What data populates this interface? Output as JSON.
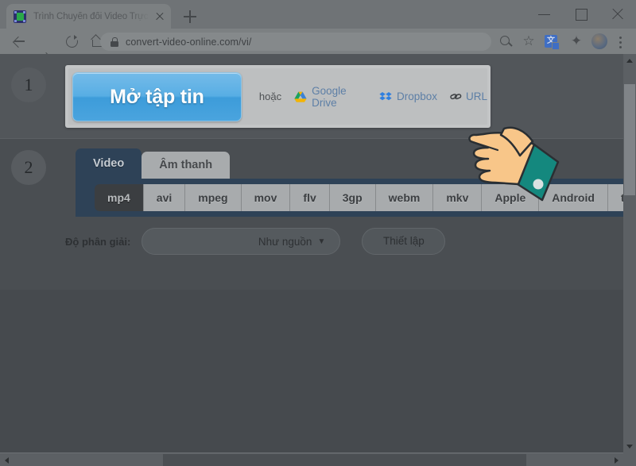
{
  "browser": {
    "tab": {
      "title": "Trình Chuyển đổi Video Trực tuyến",
      "favicon": "video-converter-favicon",
      "close_icon": "close-icon"
    },
    "new_tab_label": "+",
    "window_controls": {
      "minimize": "minimize-icon",
      "maximize": "maximize-icon",
      "close": "close-icon"
    },
    "nav": {
      "back": "back-arrow-icon",
      "forward": "forward-arrow-icon",
      "reload": "reload-icon",
      "home": "home-icon"
    },
    "omnibox": {
      "lock": "lock-icon",
      "url": "convert-video-online.com/vi/"
    },
    "toolbar_icons": {
      "zoom": "search-zoom-icon",
      "bookmark": "star-icon",
      "translate": "translate-icon",
      "translate_glyph": "文",
      "extensions": "puzzle-piece-icon",
      "avatar": "profile-avatar",
      "menu": "three-dot-menu-icon"
    }
  },
  "page": {
    "step1": {
      "number": "1",
      "open_file_button": "Mở tập tin",
      "or_text": "hoặc",
      "sources": [
        {
          "label": "Google Drive",
          "icon": "google-drive-icon"
        },
        {
          "label": "Dropbox",
          "icon": "dropbox-icon"
        },
        {
          "label": "URL",
          "icon": "link-icon"
        }
      ]
    },
    "step2": {
      "number": "2",
      "media_tabs": [
        {
          "label": "Video",
          "active": true
        },
        {
          "label": "Âm thanh",
          "active": false
        }
      ],
      "formats": [
        {
          "label": "mp4",
          "selected": true
        },
        {
          "label": "avi",
          "selected": false
        },
        {
          "label": "mpeg",
          "selected": false
        },
        {
          "label": "mov",
          "selected": false
        },
        {
          "label": "flv",
          "selected": false
        },
        {
          "label": "3gp",
          "selected": false
        },
        {
          "label": "webm",
          "selected": false
        },
        {
          "label": "mkv",
          "selected": false
        },
        {
          "label": "Apple",
          "selected": false
        },
        {
          "label": "Android",
          "selected": false
        },
        {
          "label": "thêm",
          "selected": false
        }
      ],
      "resolution_label": "Độ phân giải:",
      "resolution_value": "Như nguồn",
      "resolution_caret": "▼",
      "settings_button": "Thiết lập"
    }
  },
  "overlay": {
    "cursor": "pointing-hand-cursor",
    "skin_color": "#f8c689",
    "sleeve_color": "#14887e"
  },
  "scrollbars": {
    "vertical": {
      "up": "scroll-up-arrow",
      "down": "scroll-down-arrow"
    },
    "horizontal": {
      "left": "scroll-left-arrow",
      "right": "scroll-right-arrow"
    }
  }
}
